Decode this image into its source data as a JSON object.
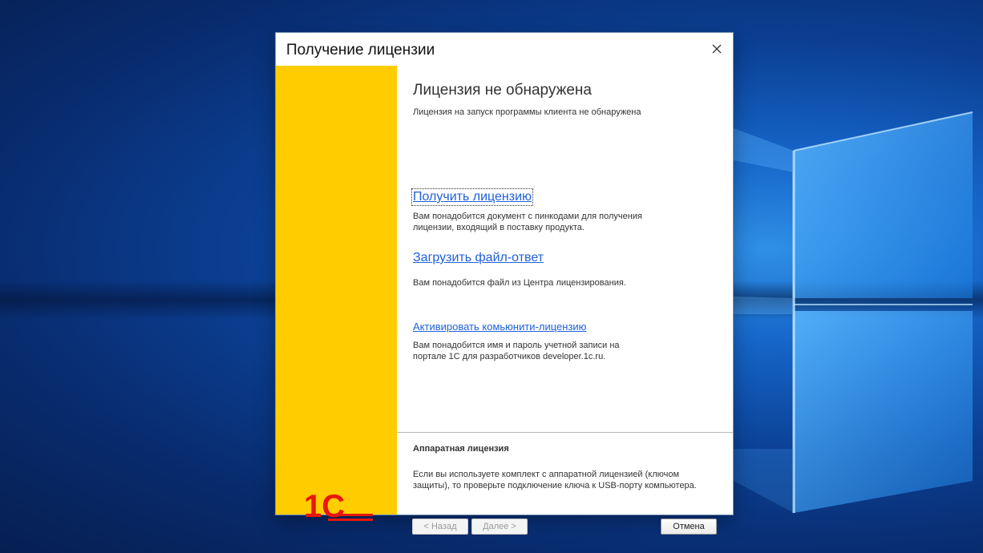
{
  "dialog": {
    "title": "Получение лицензии",
    "close_icon": "close-icon"
  },
  "brand": {
    "logo_text": "1С",
    "color": "#ffcc00",
    "logo_color": "#e8160c"
  },
  "main": {
    "heading": "Лицензия не обнаружена",
    "subtext": "Лицензия на запуск программы клиента не обнаружена",
    "options": [
      {
        "link": "Получить лицензию",
        "description": "Вам понадобится документ с пинкодами для получения лицензии, входящий в поставку продукта."
      },
      {
        "link": "Загрузить файл-ответ",
        "description": "Вам понадобится файл из Центра лицензирования."
      },
      {
        "link": "Активировать комьюнити-лицензию",
        "description": "Вам понадобится имя и пароль учетной записи на портале 1С для разработчиков developer.1c.ru."
      }
    ]
  },
  "hardware": {
    "title": "Аппаратная лицензия",
    "description": "Если вы используете комплект с аппаратной лицензией (ключом защиты), то проверьте подключение ключа к USB-порту компьютера."
  },
  "buttons": {
    "back": "< Назад",
    "next": "Далее >",
    "cancel": "Отмена"
  },
  "colors": {
    "link": "#1f60d8",
    "desktop": "#0b3f93"
  }
}
